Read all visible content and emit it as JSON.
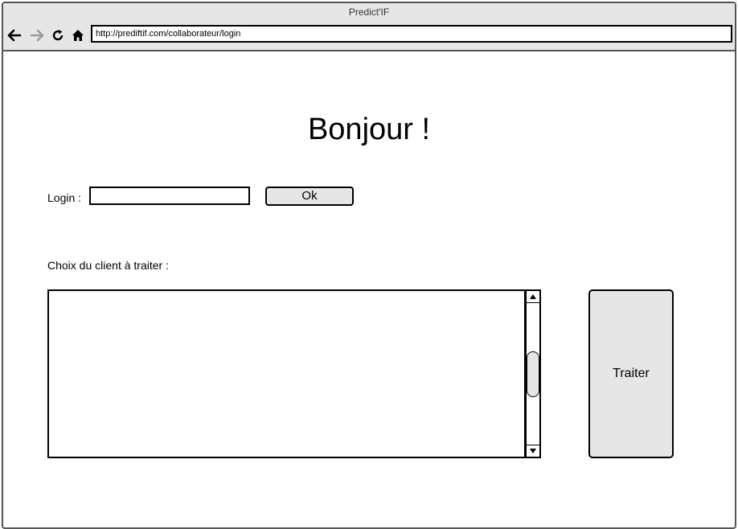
{
  "browser": {
    "title": "Predict'IF",
    "url": "http://prediftif.com/collaborateur/login",
    "icons": [
      "back-arrow-icon",
      "forward-arrow-icon",
      "reload-icon",
      "home-icon"
    ]
  },
  "page": {
    "heading": "Bonjour !",
    "login": {
      "label": "Login :",
      "value": "",
      "button_label": "Ok"
    },
    "client_choice": {
      "label": "Choix du client à traiter :",
      "items": []
    },
    "process_button_label": "Traiter"
  },
  "colors": {
    "chrome_bg": "#e6e6e6",
    "button_bg": "#e6e6e6",
    "border": "#000000"
  }
}
